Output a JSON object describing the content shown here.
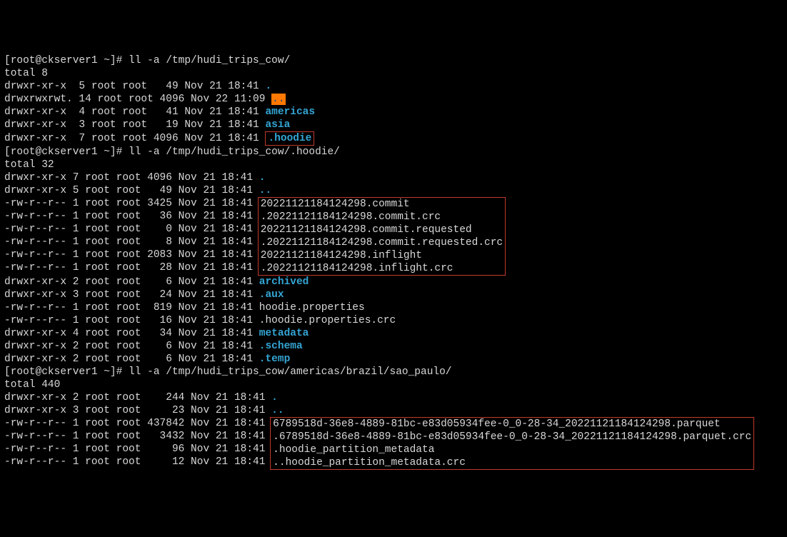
{
  "prompt": {
    "user": "root",
    "host": "ckserver1",
    "cwd": "~",
    "sep": "]#"
  },
  "cmd1": "ll -a /tmp/hudi_trips_cow/",
  "total1": "total 8",
  "ls1": [
    {
      "perm": "drwxr-xr-x",
      "links": "5",
      "owner": "root",
      "group": "root",
      "size": "49",
      "date": "Nov 21 18:41",
      "name": ".",
      "cls": "dircolor"
    },
    {
      "perm": "drwxrwxrwt.",
      "links": "14",
      "owner": "root",
      "group": "root",
      "size": "4096",
      "date": "Nov 22 11:09",
      "name": "..",
      "cls": "hilite"
    },
    {
      "perm": "drwxr-xr-x",
      "links": "4",
      "owner": "root",
      "group": "root",
      "size": "41",
      "date": "Nov 21 18:41",
      "name": "americas",
      "cls": "dircolor"
    },
    {
      "perm": "drwxr-xr-x",
      "links": "3",
      "owner": "root",
      "group": "root",
      "size": "19",
      "date": "Nov 21 18:41",
      "name": "asia",
      "cls": "dircolor"
    },
    {
      "perm": "drwxr-xr-x",
      "links": "7",
      "owner": "root",
      "group": "root",
      "size": "4096",
      "date": "Nov 21 18:41",
      "name": ".hoodie",
      "cls": "dircolor box"
    }
  ],
  "cmd2": "ll -a /tmp/hudi_trips_cow/.hoodie/",
  "total2": "total 32",
  "ls2_before": [
    {
      "perm": "drwxr-xr-x",
      "links": "7",
      "owner": "root",
      "group": "root",
      "size": "4096",
      "date": "Nov 21 18:41",
      "name": ".",
      "cls": "dircolor"
    },
    {
      "perm": "drwxr-xr-x",
      "links": "5",
      "owner": "root",
      "group": "root",
      "size": "49",
      "date": "Nov 21 18:41",
      "name": "..",
      "cls": "dircolor"
    }
  ],
  "ls2_box_left": [
    {
      "perm": "-rw-r--r--",
      "links": "1",
      "owner": "root",
      "group": "root",
      "size": "3425",
      "date": "Nov 21 18:41"
    },
    {
      "perm": "-rw-r--r--",
      "links": "1",
      "owner": "root",
      "group": "root",
      "size": "36",
      "date": "Nov 21 18:41"
    },
    {
      "perm": "-rw-r--r--",
      "links": "1",
      "owner": "root",
      "group": "root",
      "size": "0",
      "date": "Nov 21 18:41"
    },
    {
      "perm": "-rw-r--r--",
      "links": "1",
      "owner": "root",
      "group": "root",
      "size": "8",
      "date": "Nov 21 18:41"
    },
    {
      "perm": "-rw-r--r--",
      "links": "1",
      "owner": "root",
      "group": "root",
      "size": "2083",
      "date": "Nov 21 18:41"
    },
    {
      "perm": "-rw-r--r--",
      "links": "1",
      "owner": "root",
      "group": "root",
      "size": "28",
      "date": "Nov 21 18:41"
    }
  ],
  "ls2_box_right": [
    "20221121184124298.commit",
    ".20221121184124298.commit.crc",
    "20221121184124298.commit.requested",
    ".20221121184124298.commit.requested.crc",
    "20221121184124298.inflight",
    ".20221121184124298.inflight.crc"
  ],
  "ls2_after": [
    {
      "perm": "drwxr-xr-x",
      "links": "2",
      "owner": "root",
      "group": "root",
      "size": "6",
      "date": "Nov 21 18:41",
      "name": "archived",
      "cls": "dircolor"
    },
    {
      "perm": "drwxr-xr-x",
      "links": "3",
      "owner": "root",
      "group": "root",
      "size": "24",
      "date": "Nov 21 18:41",
      "name": ".aux",
      "cls": "dircolor"
    },
    {
      "perm": "-rw-r--r--",
      "links": "1",
      "owner": "root",
      "group": "root",
      "size": "819",
      "date": "Nov 21 18:41",
      "name": "hoodie.properties",
      "cls": "white"
    },
    {
      "perm": "-rw-r--r--",
      "links": "1",
      "owner": "root",
      "group": "root",
      "size": "16",
      "date": "Nov 21 18:41",
      "name": ".hoodie.properties.crc",
      "cls": "white"
    },
    {
      "perm": "drwxr-xr-x",
      "links": "4",
      "owner": "root",
      "group": "root",
      "size": "34",
      "date": "Nov 21 18:41",
      "name": "metadata",
      "cls": "dircolor"
    },
    {
      "perm": "drwxr-xr-x",
      "links": "2",
      "owner": "root",
      "group": "root",
      "size": "6",
      "date": "Nov 21 18:41",
      "name": ".schema",
      "cls": "dircolor"
    },
    {
      "perm": "drwxr-xr-x",
      "links": "2",
      "owner": "root",
      "group": "root",
      "size": "6",
      "date": "Nov 21 18:41",
      "name": ".temp",
      "cls": "dircolor"
    }
  ],
  "cmd3": "ll -a /tmp/hudi_trips_cow/americas/brazil/sao_paulo/",
  "total3": "total 440",
  "ls3_before": [
    {
      "perm": "drwxr-xr-x",
      "links": "2",
      "owner": "root",
      "group": "root",
      "size": "244",
      "date": "Nov 21 18:41",
      "name": ".",
      "cls": "dircolor"
    },
    {
      "perm": "drwxr-xr-x",
      "links": "3",
      "owner": "root",
      "group": "root",
      "size": "23",
      "date": "Nov 21 18:41",
      "name": "..",
      "cls": "dircolor"
    }
  ],
  "ls3_box_left": [
    {
      "perm": "-rw-r--r--",
      "links": "1",
      "owner": "root",
      "group": "root",
      "size": "437842",
      "date": "Nov 21 18:41"
    },
    {
      "perm": "-rw-r--r--",
      "links": "1",
      "owner": "root",
      "group": "root",
      "size": "3432",
      "date": "Nov 21 18:41"
    },
    {
      "perm": "-rw-r--r--",
      "links": "1",
      "owner": "root",
      "group": "root",
      "size": "96",
      "date": "Nov 21 18:41"
    },
    {
      "perm": "-rw-r--r--",
      "links": "1",
      "owner": "root",
      "group": "root",
      "size": "12",
      "date": "Nov 21 18:41"
    }
  ],
  "ls3_box_right": [
    "6789518d-36e8-4889-81bc-e83d05934fee-0_0-28-34_20221121184124298.parquet",
    ".6789518d-36e8-4889-81bc-e83d05934fee-0_0-28-34_20221121184124298.parquet.crc",
    ".hoodie_partition_metadata",
    "..hoodie_partition_metadata.crc"
  ]
}
